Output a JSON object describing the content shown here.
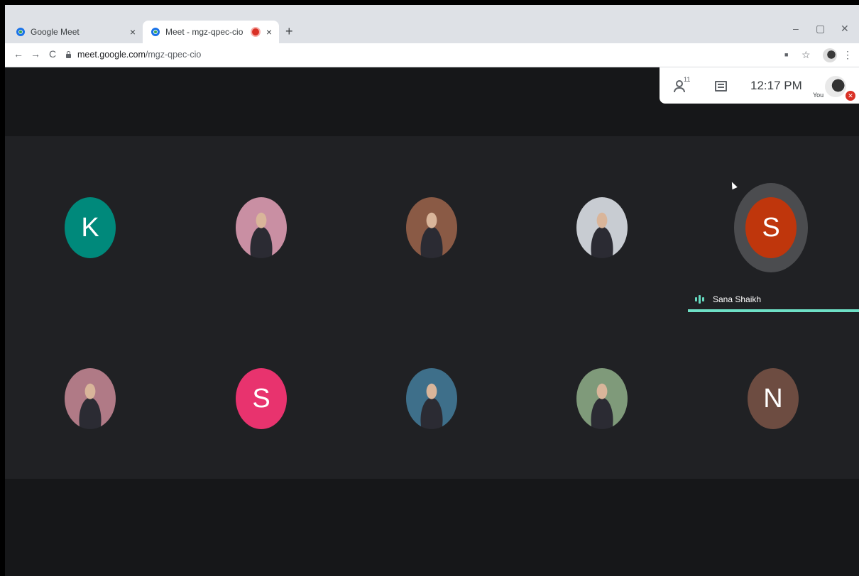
{
  "browser": {
    "tabs": [
      {
        "title": "Google Meet",
        "close": "×"
      },
      {
        "title": "Meet - mgz-qpec-cio",
        "close": "×"
      }
    ],
    "new_tab_label": "+",
    "window_controls": {
      "minimize": "–",
      "maximize": "▢",
      "close": "✕"
    },
    "nav": {
      "back": "←",
      "forward": "→",
      "reload": "C"
    },
    "url": {
      "host": "meet.google.com",
      "path": "/mgz-qpec-cio"
    },
    "toolbar_icons": {
      "camera": "■",
      "star": "☆",
      "menu": "⋮"
    }
  },
  "meet": {
    "participant_count": "11",
    "time": "12:17 PM",
    "you_label": "You",
    "active_speaker": "Sana Shaikh",
    "participants": [
      {
        "initial": "K",
        "color": "#00897b"
      },
      {
        "initial": "",
        "color": "#c98fa3"
      },
      {
        "initial": "",
        "color": "#8a5a45"
      },
      {
        "initial": "",
        "color": "#c8ccd2"
      },
      {
        "initial": "S",
        "color": "#bf360c"
      },
      {
        "initial": "",
        "color": "#b07a86"
      },
      {
        "initial": "S",
        "color": "#e8336e"
      },
      {
        "initial": "",
        "color": "#3e6f8a"
      },
      {
        "initial": "",
        "color": "#7f9a7a"
      },
      {
        "initial": "N",
        "color": "#6d4c41"
      }
    ]
  }
}
